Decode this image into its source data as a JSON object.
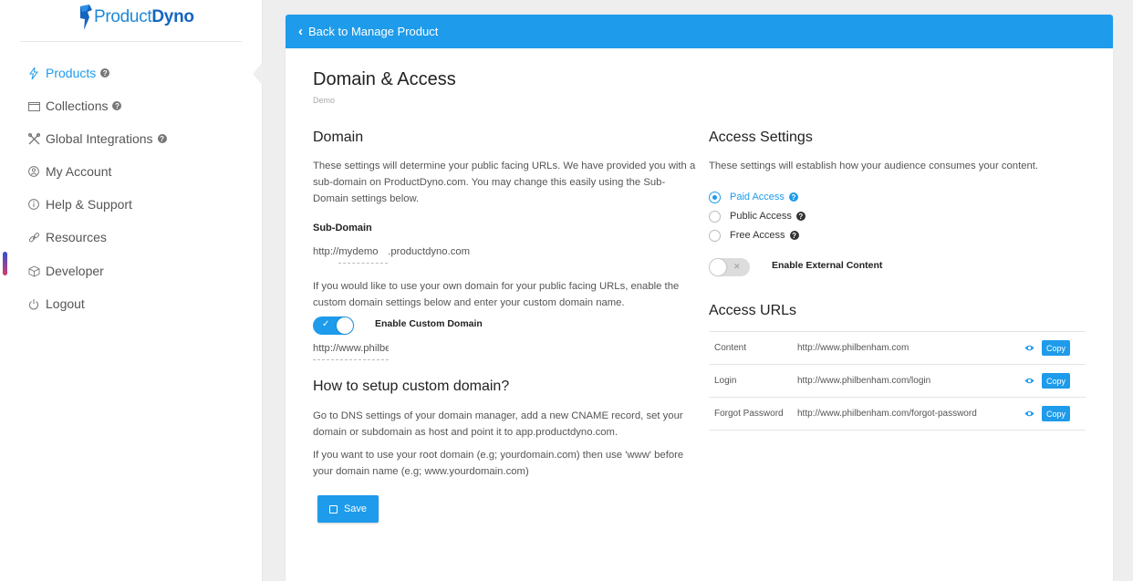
{
  "brand": {
    "logo_text_light": "Product",
    "logo_text_bold": "Dyno",
    "accent": "#1e9bea"
  },
  "sidebar": {
    "items": [
      {
        "label": "Products",
        "icon": "bolt-icon",
        "help": true,
        "active": true
      },
      {
        "label": "Collections",
        "icon": "folder-icon",
        "help": true
      },
      {
        "label": "Global Integrations",
        "icon": "tools-icon",
        "help": true
      },
      {
        "label": "My Account",
        "icon": "user-circle-icon"
      },
      {
        "label": "Help & Support",
        "icon": "info-circle-icon"
      },
      {
        "label": "Resources",
        "icon": "link-icon"
      },
      {
        "label": "Developer",
        "icon": "cube-icon"
      },
      {
        "label": "Logout",
        "icon": "power-icon"
      }
    ]
  },
  "header": {
    "back_label": "Back to Manage Product"
  },
  "page": {
    "title": "Domain & Access",
    "subtitle": "Demo"
  },
  "domain": {
    "heading": "Domain",
    "description": "These settings will determine your public facing URLs. We have provided you with a sub-domain on ProductDyno.com. You may change this easily using the Sub-Domain settings below.",
    "subdomain_label": "Sub-Domain",
    "subdomain_prefix": "http://",
    "subdomain_value": "mydemo",
    "subdomain_suffix": ".productdyno.com",
    "custom_description": "If you would like to use your own domain for your public facing URLs, enable the custom domain settings below and enter your custom domain name.",
    "custom_toggle_label": "Enable Custom Domain",
    "custom_domain_value": "http://www.philben",
    "custom_enabled": true
  },
  "setup": {
    "heading": "How to setup custom domain?",
    "para1": "Go to DNS settings of your domain manager, add a new CNAME record, set your domain or subdomain as host and point it to app.productdyno.com.",
    "para2": "If you want to use your root domain (e.g; yourdomain.com) then use 'www' before your domain name (e.g; www.yourdomain.com)"
  },
  "save_label": "Save",
  "access": {
    "heading": "Access Settings",
    "description": "These settings will establish how your audience consumes your content.",
    "options": [
      {
        "label": "Paid Access",
        "selected": true
      },
      {
        "label": "Public Access",
        "selected": false
      },
      {
        "label": "Free Access",
        "selected": false
      }
    ],
    "external_toggle_label": "Enable External Content",
    "external_enabled": false
  },
  "access_urls": {
    "heading": "Access URLs",
    "copy_label": "Copy",
    "rows": [
      {
        "label": "Content",
        "url": "http://www.philbenham.com"
      },
      {
        "label": "Login",
        "url": "http://www.philbenham.com/login"
      },
      {
        "label": "Forgot Password",
        "url": "http://www.philbenham.com/forgot-password"
      }
    ]
  }
}
